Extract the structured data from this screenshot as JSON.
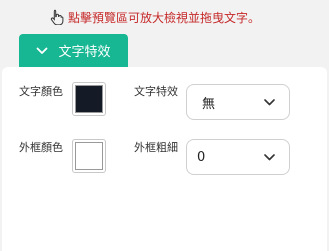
{
  "hint": {
    "text": "點擊預覽區可放大檢視並拖曳文字。",
    "icon": "pointer-hand-icon",
    "color": "#c62828"
  },
  "tab": {
    "label": "文字特效",
    "icon": "chevron-down-icon",
    "color": "#17b793"
  },
  "panel": {
    "text_color_label": "文字顏色",
    "text_color_value": "#141a26",
    "text_effect_label": "文字特效",
    "text_effect_value": "無",
    "stroke_color_label": "外框顏色",
    "stroke_color_value": "#ffffff",
    "stroke_width_label": "外框粗細",
    "stroke_width_value": "0"
  }
}
